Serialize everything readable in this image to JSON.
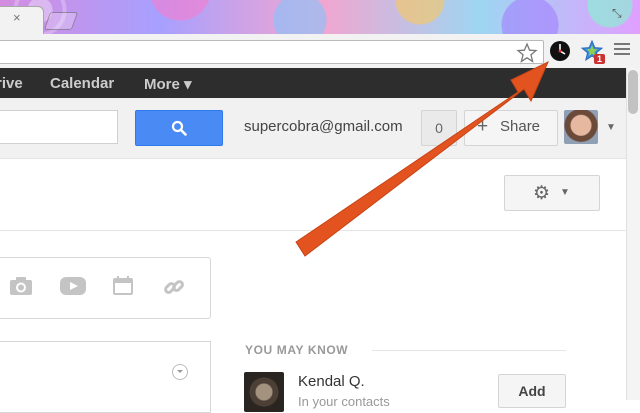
{
  "browser": {
    "tab_close_glyph": "×",
    "ext_badge": "1"
  },
  "nav": {
    "items": [
      "rive",
      "Calendar",
      "More ▾"
    ]
  },
  "header": {
    "account_email": "supercobra@gmail.com",
    "notifications_count": "0",
    "share_plus": "+",
    "share_label": "Share"
  },
  "you_may_know": {
    "title": "YOU MAY KNOW",
    "person_name": "Kendal Q.",
    "person_sub": "In your contacts",
    "add_label": "Add"
  },
  "colors": {
    "gbar": "#2d2d2d",
    "search_blue": "#4a8af4",
    "arrow": "#e2531f"
  },
  "icons": [
    "star-icon",
    "clock-icon",
    "extension-star-icon",
    "menu-icon",
    "search-icon",
    "gear-icon",
    "camera-icon",
    "video-icon",
    "calendar-icon",
    "link-icon",
    "dropdown-circle-icon"
  ]
}
